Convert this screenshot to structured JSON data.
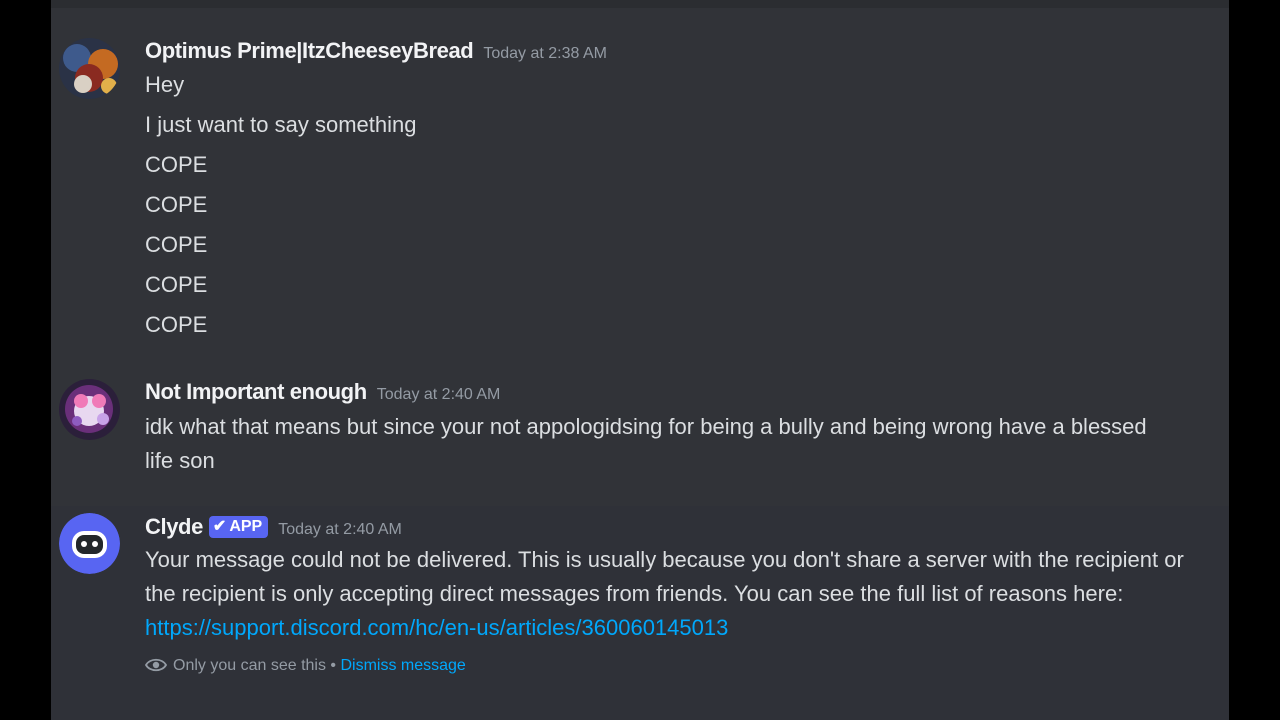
{
  "messages": [
    {
      "username": "Optimus Prime|ItzCheeseyBread",
      "timestamp": "Today at 2:38 AM",
      "lines": [
        "Hey",
        "I just want to say something",
        "COPE",
        "COPE",
        "COPE",
        "COPE",
        "COPE"
      ]
    },
    {
      "username": "Not Important enough",
      "timestamp": "Today at 2:40 AM",
      "text_color": "#e5484d",
      "text": "idk what that means but since your not appologidsing for being a bully and being wrong have a blessed life son"
    },
    {
      "username": "Clyde",
      "badge": "APP",
      "badge_icon": "checkmark-icon",
      "timestamp": "Today at 2:40 AM",
      "text": "Your message could not be delivered. This is usually because you don't share a server with the recipient or the recipient is only accepting direct messages from friends. You can see the full list of reasons here: ",
      "link": "https://support.discord.com/hc/en-us/articles/360060145013",
      "ephemeral_note": "Only you can see this",
      "separator": " • ",
      "dismiss_label": "Dismiss message"
    }
  ],
  "colors": {
    "background": "#313338",
    "username": "#f2f3f5",
    "text": "#dbdee1",
    "timestamp": "#949ba4",
    "link": "#00a8fc",
    "app_badge": "#5865f2"
  }
}
